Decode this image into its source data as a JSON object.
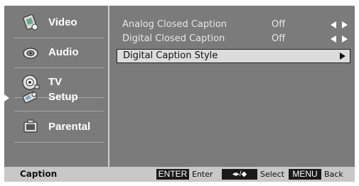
{
  "sidebar": {
    "items": [
      {
        "label": "Video",
        "icon": "video-icon"
      },
      {
        "label": "Audio",
        "icon": "audio-icon"
      },
      {
        "label": "TV",
        "icon": "tv-icon"
      },
      {
        "label": "Setup",
        "icon": "setup-icon"
      },
      {
        "label": "Parental",
        "icon": "parental-icon"
      }
    ],
    "active_index": 3
  },
  "options": [
    {
      "name": "Analog Closed Caption",
      "value": "Off"
    },
    {
      "name": "Digital Closed Caption",
      "value": "Off"
    },
    {
      "name": "Digital Caption Style",
      "value": ""
    }
  ],
  "statusbar": {
    "section": "Caption",
    "enter_key": "ENTER",
    "enter_label": "Enter",
    "nav_key": "◂▸/◆",
    "nav_label": "Select",
    "menu_key": "MENU",
    "menu_label": "Back"
  },
  "colors": {
    "panel": "#7b7b7b",
    "status_bar": "#c8c8c8",
    "highlight": "#dcdcdc",
    "key_bg": "#1a1a1a"
  }
}
